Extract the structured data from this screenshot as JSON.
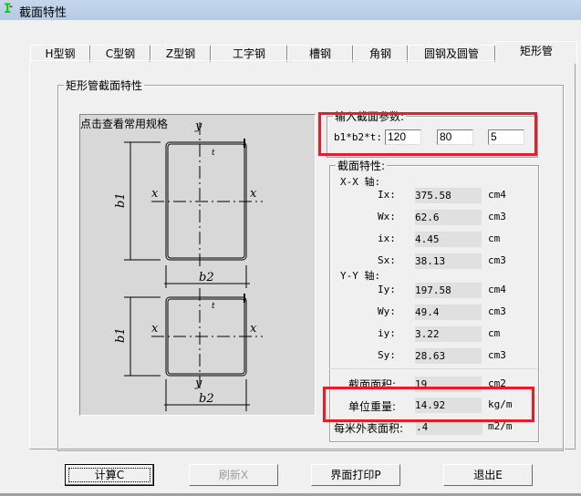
{
  "window": {
    "title": "截面特性",
    "icon": "section-steel-icon"
  },
  "tabs": [
    {
      "label": "H型钢",
      "active": false
    },
    {
      "label": "C型钢",
      "active": false
    },
    {
      "label": "Z型钢",
      "active": false
    },
    {
      "label": "工字钢",
      "active": false
    },
    {
      "label": "槽钢",
      "active": false
    },
    {
      "label": "角钢",
      "active": false
    },
    {
      "label": "圆钢及圆管",
      "active": false
    },
    {
      "label": "矩形管",
      "active": true
    }
  ],
  "section_group": {
    "title": "矩形管截面特性",
    "drawing_hint": "点击查看常用规格",
    "diagram_labels": {
      "y": "y",
      "x": "x",
      "b1": "b1",
      "b2": "b2",
      "t": "t"
    }
  },
  "input_group": {
    "title": "输入截面参数:",
    "param_label": "b1*b2*t:",
    "b1": "120",
    "b2": "80",
    "t": "5"
  },
  "properties": {
    "title": "截面特性:",
    "xx_axis_label": "X-X 轴:",
    "yy_axis_label": "Y-Y 轴:",
    "xx": [
      {
        "label": "Ix:",
        "value": "375.58",
        "unit": "cm4"
      },
      {
        "label": "Wx:",
        "value": "62.6",
        "unit": "cm3"
      },
      {
        "label": "ix:",
        "value": "4.45",
        "unit": "cm"
      },
      {
        "label": "Sx:",
        "value": "38.13",
        "unit": "cm3"
      }
    ],
    "yy": [
      {
        "label": "Iy:",
        "value": "197.58",
        "unit": "cm4"
      },
      {
        "label": "Wy:",
        "value": "49.4",
        "unit": "cm3"
      },
      {
        "label": "iy:",
        "value": "3.22",
        "unit": "cm"
      },
      {
        "label": "Sy:",
        "value": "28.63",
        "unit": "cm3"
      }
    ],
    "area": {
      "label": "截面面积:",
      "value": "19",
      "unit": "cm2"
    },
    "unit_weight": {
      "label": "单位重量:",
      "value": "14.92",
      "unit": "kg/m"
    },
    "surface_area": {
      "label": "每米外表面积:",
      "value": ".4",
      "unit": "m2/m"
    }
  },
  "buttons": {
    "calculate": "计算C",
    "refresh": "刷新X",
    "print": "界面打印P",
    "exit": "退出E"
  },
  "highlight_color": "#ed1c24"
}
